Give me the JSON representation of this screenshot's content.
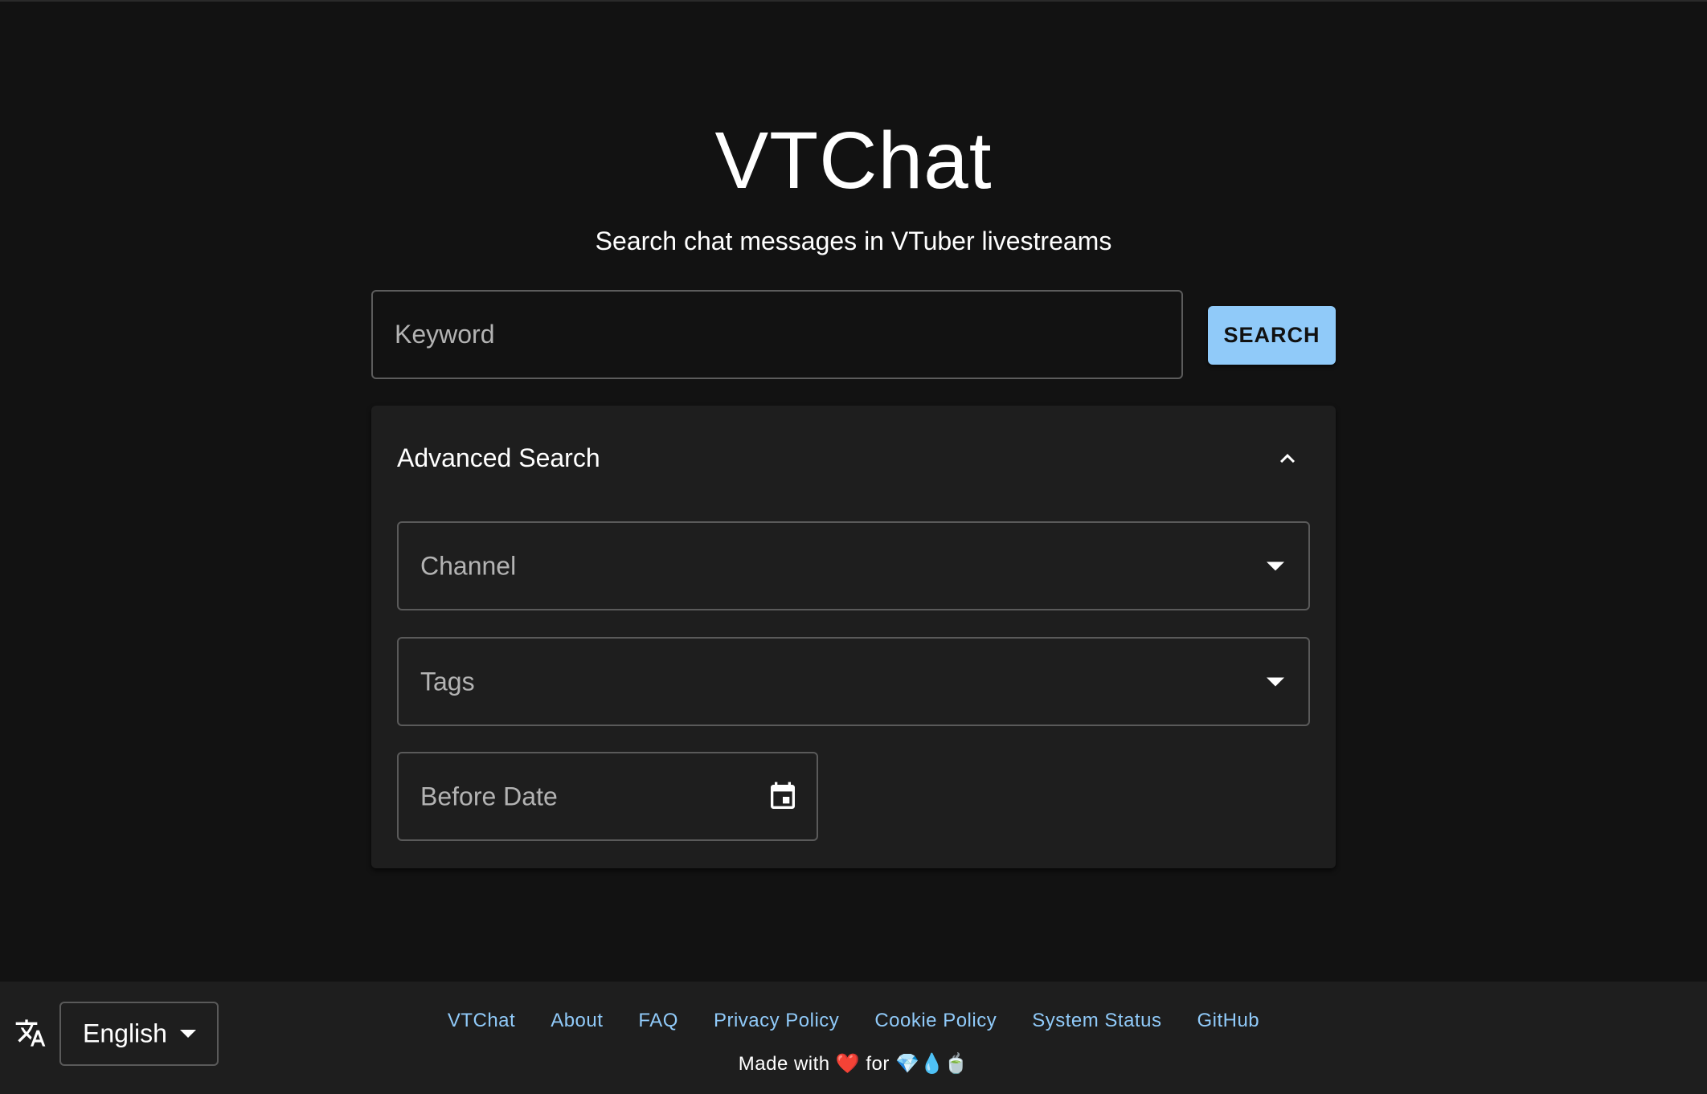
{
  "header": {
    "title": "VTChat",
    "subtitle": "Search chat messages in VTuber livestreams"
  },
  "search": {
    "keyword_placeholder": "Keyword",
    "keyword_value": "",
    "button_label": "SEARCH"
  },
  "advanced": {
    "title": "Advanced Search",
    "expanded": true,
    "channel_label": "Channel",
    "tags_label": "Tags",
    "before_date_label": "Before Date"
  },
  "footer": {
    "language": "English",
    "links": [
      "VTChat",
      "About",
      "FAQ",
      "Privacy Policy",
      "Cookie Policy",
      "System Status",
      "GitHub"
    ],
    "made_with_prefix": "Made with",
    "made_with_heart": "❤️",
    "made_with_for": "for",
    "made_with_emojis": "💎💧🍵"
  },
  "colors": {
    "background": "#121212",
    "surface": "#1e1e1e",
    "accent": "#90caf9"
  }
}
